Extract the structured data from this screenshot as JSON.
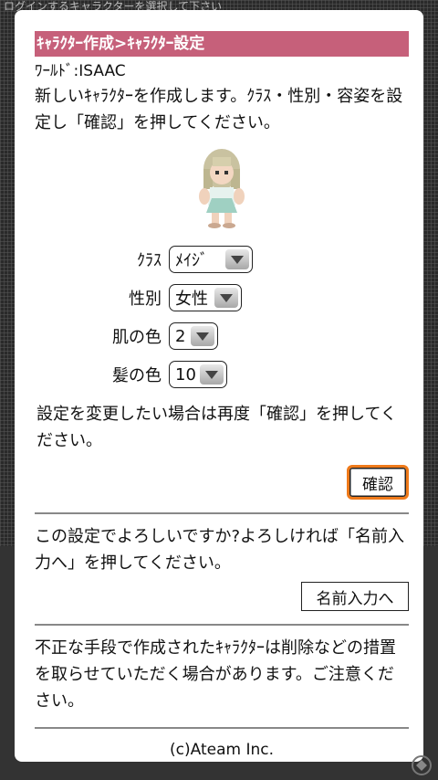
{
  "background": {
    "top_text": "ログインするキャラクターを選択して下さい"
  },
  "dialog": {
    "title": "ｷｬﾗｸﾀｰ作成>ｷｬﾗｸﾀｰ設定",
    "world": "ﾜｰﾙﾄﾞ:ISAAC",
    "intro": "新しいｷｬﾗｸﾀｰを作成します。ｸﾗｽ・性別・容姿を設定し「確認」を押してください。",
    "form": {
      "class_label": "ｸﾗｽ",
      "class_value": "ﾒｲｼﾞ",
      "gender_label": "性別",
      "gender_value": "女性",
      "skin_label": "肌の色",
      "skin_value": "2",
      "hair_label": "髪の色",
      "hair_value": "10"
    },
    "change_note": "設定を変更したい場合は再度「確認」を押してください。",
    "confirm_label": "確認",
    "ok_question": "この設定でよろしいですか?よろしければ「名前入力へ」を押してください。",
    "name_button_label": "名前入力へ",
    "warning": "不正な手段で作成されたｷｬﾗｸﾀｰは削除などの措置を取らせていただく場合があります。ご注意ください。",
    "footer": "(c)Ateam Inc."
  },
  "colors": {
    "title_bar": "#c6607a",
    "confirm_border": "#ef7a1a"
  },
  "icons": {
    "dropdown": "chevron-down-icon",
    "character": "character-sprite",
    "watermark": "site-logo-icon"
  }
}
